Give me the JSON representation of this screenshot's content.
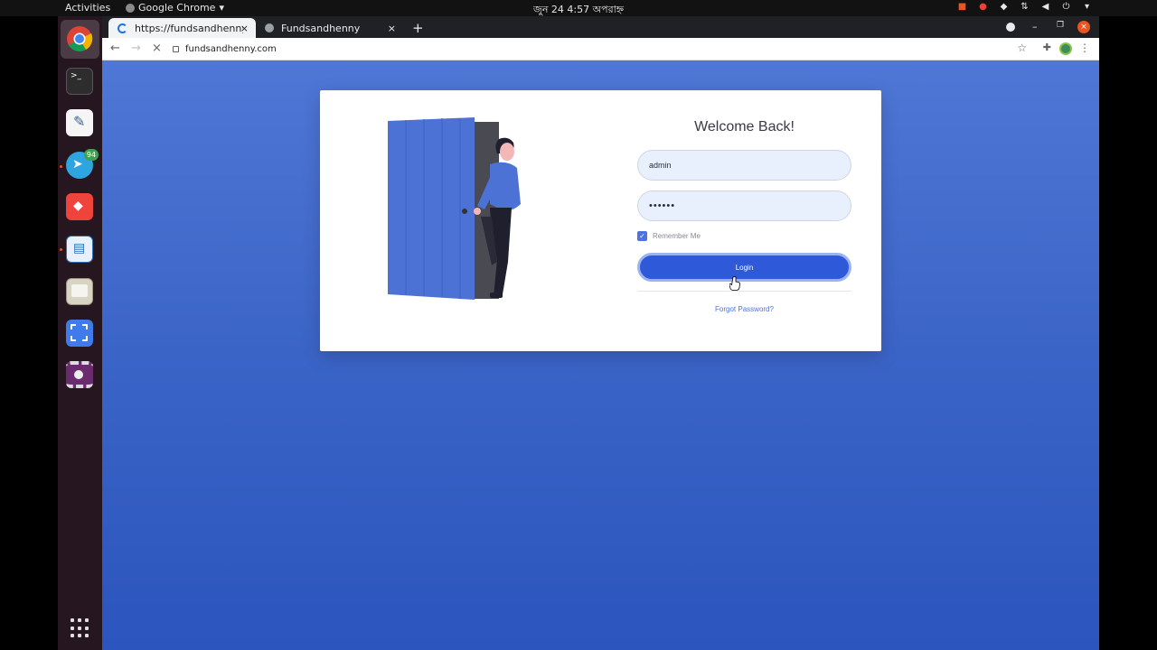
{
  "topbar": {
    "activities": "Activities",
    "app_name": "Google Chrome",
    "clock": "জুন 24  4:57 অপরাহ্ন"
  },
  "dock": {
    "telegram_badge": "94"
  },
  "browser": {
    "tabs": [
      {
        "label": "https://fundsandhenny.c"
      },
      {
        "label": "Fundsandhenny"
      }
    ],
    "new_tab": "+",
    "url": "fundsandhenny.com"
  },
  "page": {
    "title": "Welcome Back!",
    "username_value": "admin",
    "password_value": "••••••",
    "remember_label": "Remember Me",
    "login_label": "Login",
    "forgot_label": "Forgot Password?"
  },
  "colors": {
    "primary": "#2e59d9",
    "background_top": "#4e77d6",
    "background_bottom": "#2c55bd",
    "ubuntu_orange": "#e95420"
  },
  "icons": {
    "close": "×",
    "back": "←",
    "forward": "→",
    "star": "☆",
    "menu": "⋮",
    "check": "✓"
  }
}
